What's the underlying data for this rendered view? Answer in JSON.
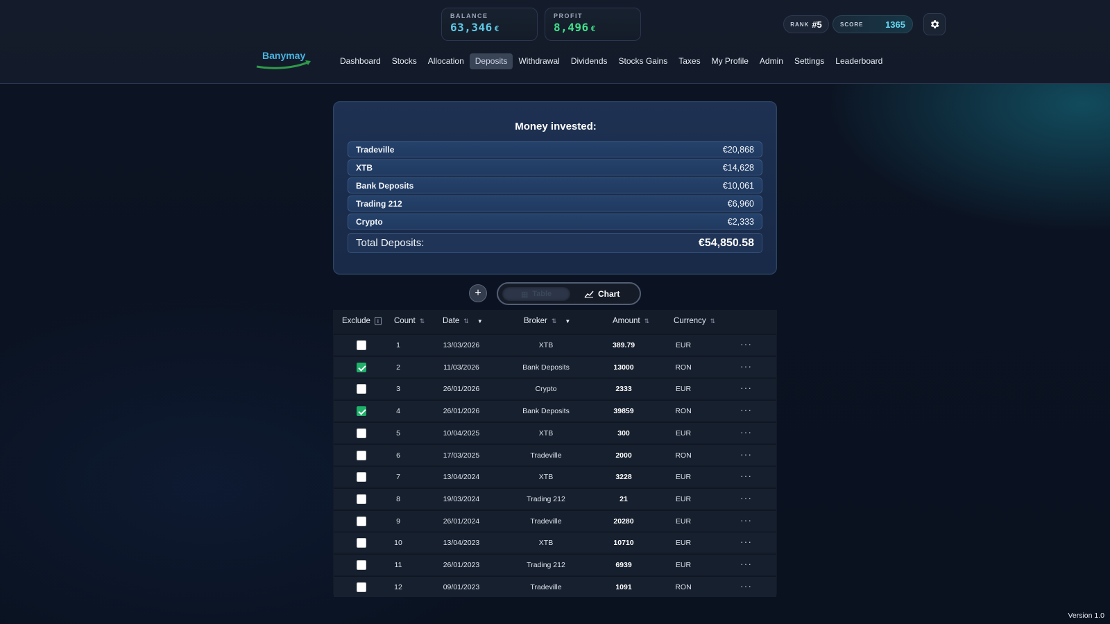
{
  "stats": {
    "balance_label": "BALANCE",
    "balance_value": "63,346",
    "balance_currency": "€",
    "profit_label": "PROFIT",
    "profit_value": "8,496",
    "profit_currency": "€",
    "rank_label": "RANK",
    "rank_value": "#5",
    "score_label": "SCORE",
    "score_value": "1365"
  },
  "brand": {
    "name": "Banymay"
  },
  "nav": [
    {
      "label": "Dashboard"
    },
    {
      "label": "Stocks"
    },
    {
      "label": "Allocation"
    },
    {
      "label": "Deposits",
      "active": true
    },
    {
      "label": "Withdrawal"
    },
    {
      "label": "Dividends"
    },
    {
      "label": "Stocks Gains"
    },
    {
      "label": "Taxes"
    },
    {
      "label": "My Profile"
    },
    {
      "label": "Admin"
    },
    {
      "label": "Settings"
    },
    {
      "label": "Leaderboard"
    }
  ],
  "invested": {
    "title": "Money invested:",
    "rows": [
      {
        "name": "Tradeville",
        "amount": "€20,868"
      },
      {
        "name": "XTB",
        "amount": "€14,628"
      },
      {
        "name": "Bank Deposits",
        "amount": "€10,061"
      },
      {
        "name": "Trading 212",
        "amount": "€6,960"
      },
      {
        "name": "Crypto",
        "amount": "€2,333"
      }
    ],
    "total_label": "Total Deposits:",
    "total_amount": "€54,850.58"
  },
  "view_toggle": {
    "table_label": "Table",
    "chart_label": "Chart",
    "add_symbol": "+"
  },
  "table": {
    "headers": {
      "exclude": "Exclude",
      "count": "Count",
      "date": "Date",
      "broker": "Broker",
      "amount": "Amount",
      "currency": "Currency"
    },
    "rows": [
      {
        "excluded": false,
        "count": "1",
        "date": "13/03/2026",
        "broker": "XTB",
        "amount": "389.79",
        "currency": "EUR"
      },
      {
        "excluded": true,
        "count": "2",
        "date": "11/03/2026",
        "broker": "Bank Deposits",
        "amount": "13000",
        "currency": "RON"
      },
      {
        "excluded": false,
        "count": "3",
        "date": "26/01/2026",
        "broker": "Crypto",
        "amount": "2333",
        "currency": "EUR"
      },
      {
        "excluded": true,
        "count": "4",
        "date": "26/01/2026",
        "broker": "Bank Deposits",
        "amount": "39859",
        "currency": "RON"
      },
      {
        "excluded": false,
        "count": "5",
        "date": "10/04/2025",
        "broker": "XTB",
        "amount": "300",
        "currency": "EUR"
      },
      {
        "excluded": false,
        "count": "6",
        "date": "17/03/2025",
        "broker": "Tradeville",
        "amount": "2000",
        "currency": "RON"
      },
      {
        "excluded": false,
        "count": "7",
        "date": "13/04/2024",
        "broker": "XTB",
        "amount": "3228",
        "currency": "EUR"
      },
      {
        "excluded": false,
        "count": "8",
        "date": "19/03/2024",
        "broker": "Trading 212",
        "amount": "21",
        "currency": "EUR"
      },
      {
        "excluded": false,
        "count": "9",
        "date": "26/01/2024",
        "broker": "Tradeville",
        "amount": "20280",
        "currency": "EUR"
      },
      {
        "excluded": false,
        "count": "10",
        "date": "13/04/2023",
        "broker": "XTB",
        "amount": "10710",
        "currency": "EUR"
      },
      {
        "excluded": false,
        "count": "11",
        "date": "26/01/2023",
        "broker": "Trading 212",
        "amount": "6939",
        "currency": "EUR"
      },
      {
        "excluded": false,
        "count": "12",
        "date": "09/01/2023",
        "broker": "Tradeville",
        "amount": "1091",
        "currency": "RON"
      }
    ]
  },
  "footer": {
    "version": "Version 1.0"
  },
  "colors": {
    "balance": "#5ec9e6",
    "profit": "#3fe08a",
    "checked": "#1fb06a",
    "accent_score": "#66d6f0"
  },
  "icons": {
    "settings": "gear-icon",
    "add": "plus-icon",
    "chart": "line-chart-icon",
    "table": "table-icon",
    "row_menu": "more-icon"
  }
}
